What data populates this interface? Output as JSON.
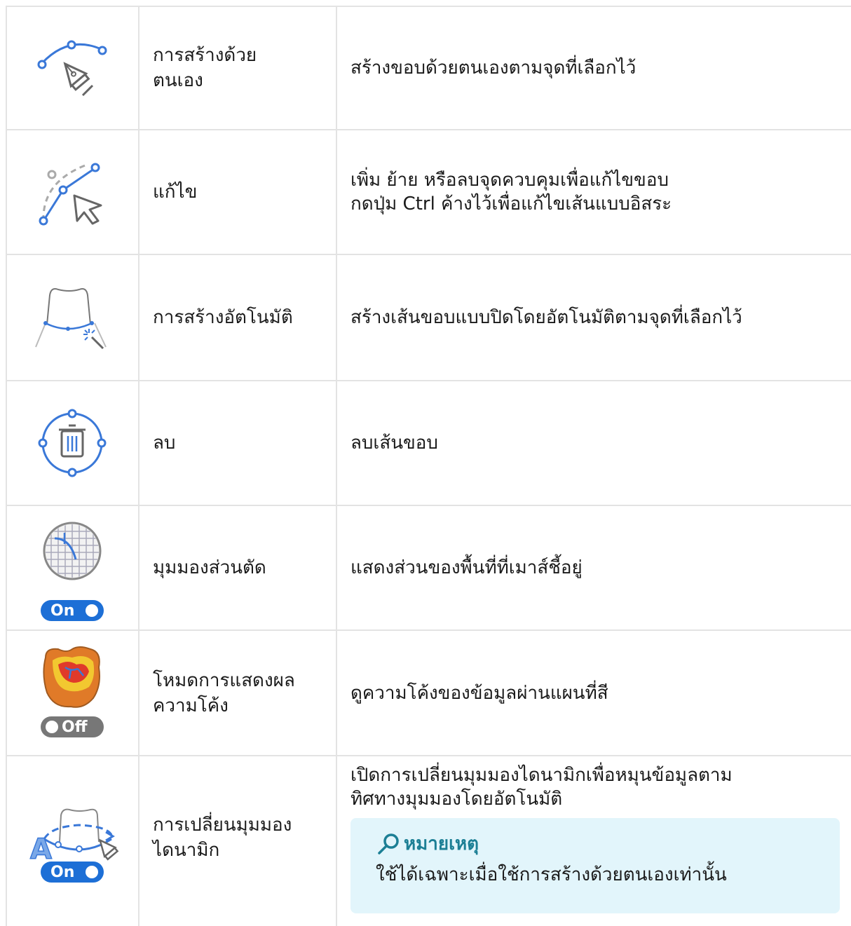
{
  "rows": [
    {
      "icon": "pen-manual-curve-icon",
      "name": "การสร้างด้วยตนเอง",
      "desc": [
        "สร้างขอบด้วยตนเองตามจุดที่เลือกไว้"
      ]
    },
    {
      "icon": "edit-curve-cursor-icon",
      "name": "แก้ไข",
      "desc": [
        "เพิ่ม ย้าย หรือลบจุดควบคุมเพื่อแก้ไขขอบ",
        "กดปุ่ม Ctrl ค้างไว้เพื่อแก้ไขเส้นแบบอิสระ"
      ]
    },
    {
      "icon": "auto-margin-tooth-icon",
      "name": "การสร้างอัตโนมัติ",
      "desc": [
        "สร้างเส้นขอบแบบปิดโดยอัตโนมัติตามจุดที่เลือกไว้"
      ]
    },
    {
      "icon": "delete-curve-trash-icon",
      "name": "ลบ",
      "desc": [
        "ลบเส้นขอบ"
      ]
    },
    {
      "icon": "cross-section-grid-icon",
      "name": "มุมมองส่วนตัด",
      "desc": [
        "แสดงส่วนของพื้นที่ที่เมาส์ชี้อยู่"
      ],
      "toggle": "On"
    },
    {
      "icon": "curvature-map-icon",
      "name": "โหมดการแสดงผลความโค้ง",
      "desc": [
        "ดูความโค้งของข้อมูลผ่านแผนที่สี"
      ],
      "toggle": "Off"
    },
    {
      "icon": "dynamic-view-rotate-icon",
      "name": "การเปลี่ยนมุมมองไดนามิก",
      "desc": [
        "เปิดการเปลี่ยนมุมมองไดนามิกเพื่อหมุนข้อมูลตาม",
        "ทิศทางมุมมองโดยอัตโนมัติ"
      ],
      "toggle": "On"
    }
  ],
  "name_lines": {
    "row0": [
      "การสร้างด้วย",
      "ตนเอง"
    ],
    "row5": [
      "โหมดการแสดงผล",
      "ความโค้ง"
    ],
    "row6": [
      "การเปลี่ยนมุมมอง",
      "ไดนามิก"
    ]
  },
  "note": {
    "icon": "magnifier-icon",
    "title": "หมายเหตุ",
    "body": "ใช้ได้เฉพาะเมื่อใช้การสร้างด้วยตนเองเท่านั้น"
  },
  "colors": {
    "accent": "#3a78d8",
    "note_bg": "#e2f5fb",
    "note_title": "#1c7f95",
    "toggle_on": "#1d6fd6",
    "toggle_off": "#777777",
    "grid": "#e3e3e3"
  }
}
